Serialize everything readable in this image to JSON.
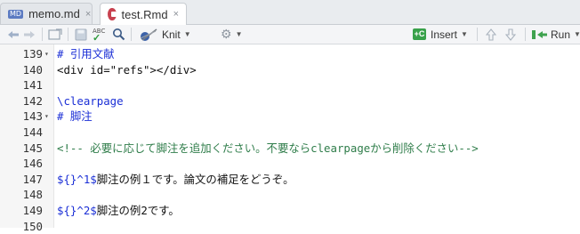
{
  "tabs": [
    {
      "icon": "md-file-icon",
      "badge": "MD",
      "label": "memo.md",
      "close": "×"
    },
    {
      "icon": "rmd-file-icon",
      "label": "test.Rmd",
      "close": "×"
    }
  ],
  "toolbar": {
    "spell_label": "ABC",
    "knit_label": "Knit",
    "insert_label": "Insert",
    "run_label": "Run"
  },
  "editor": {
    "lines": [
      {
        "num": "139",
        "fold": "▾",
        "text": "# 引用文献",
        "style": "head"
      },
      {
        "num": "140",
        "fold": "",
        "text": "<div id=\"refs\"></div>",
        "style": "text"
      },
      {
        "num": "141",
        "fold": "",
        "text": "",
        "style": "text"
      },
      {
        "num": "142",
        "fold": "",
        "text": "\\clearpage",
        "style": "latex"
      },
      {
        "num": "143",
        "fold": "▾",
        "text": "# 脚注",
        "style": "head"
      },
      {
        "num": "144",
        "fold": "",
        "text": "",
        "style": "text"
      },
      {
        "num": "145",
        "fold": "",
        "text": "<!-- 必要に応じて脚注を追加ください。不要ならclearpageから削除ください-->",
        "style": "comment"
      },
      {
        "num": "146",
        "fold": "",
        "text": "",
        "style": "text"
      },
      {
        "num": "147",
        "fold": "",
        "math": "${}^1$",
        "text": "脚注の例１です。論文の補足をどうぞ。",
        "style": "mixed"
      },
      {
        "num": "148",
        "fold": "",
        "text": "",
        "style": "text"
      },
      {
        "num": "149",
        "fold": "",
        "math": "${}^2$",
        "text": "脚注の例2です。",
        "style": "mixed"
      },
      {
        "num": "150",
        "fold": "",
        "text": "",
        "style": "text"
      }
    ]
  }
}
